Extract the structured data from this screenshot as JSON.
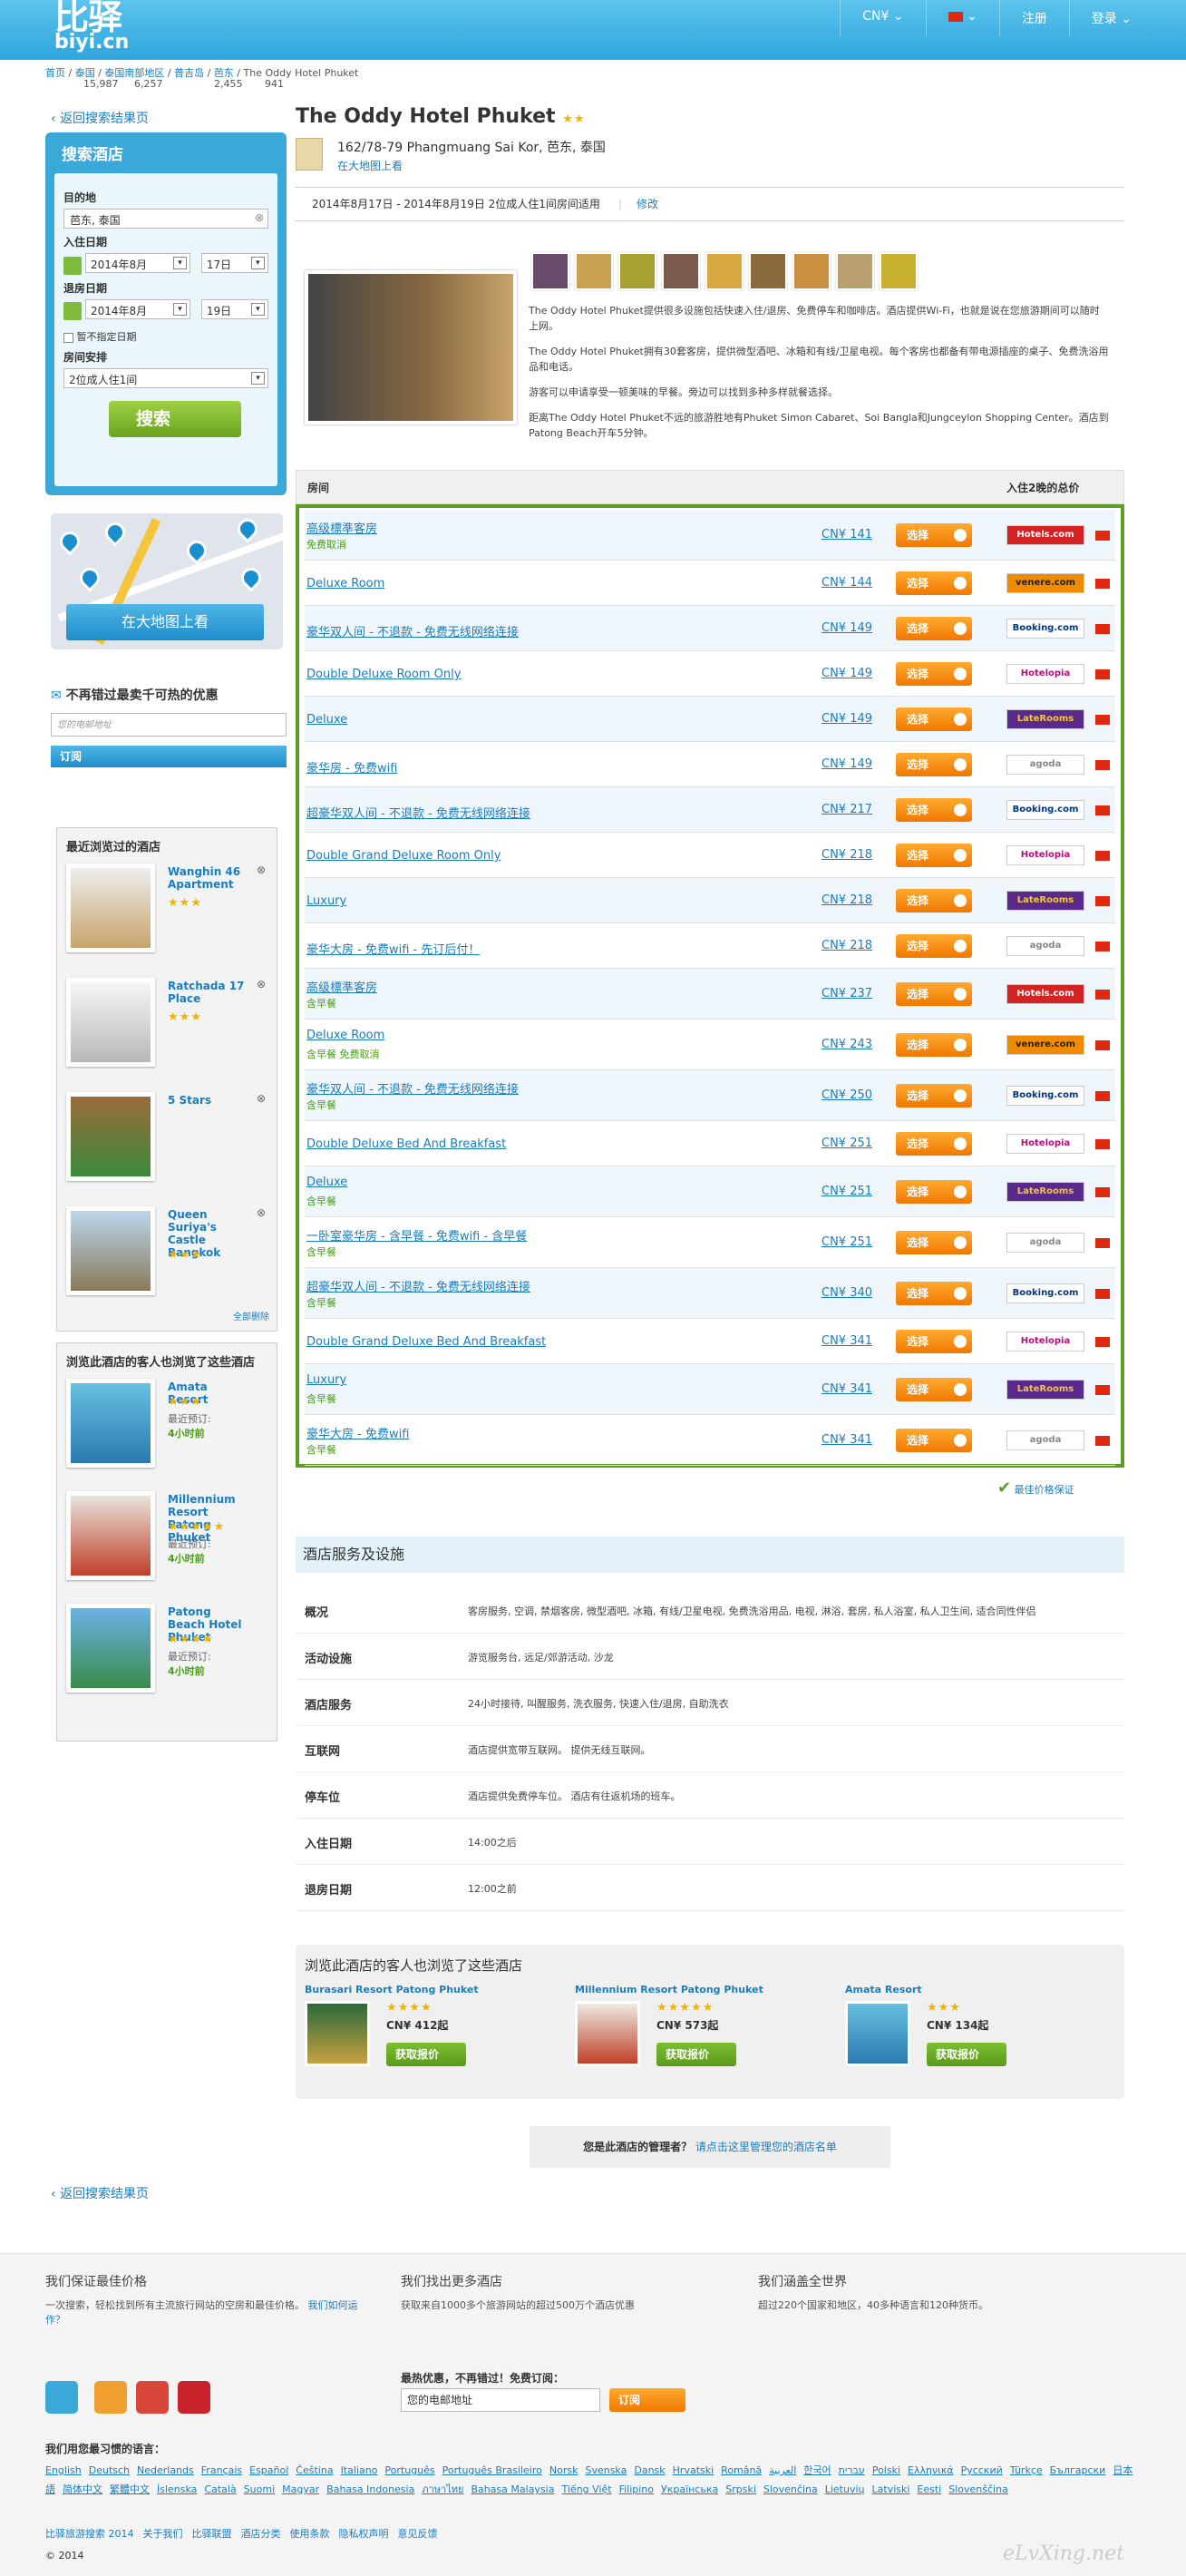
{
  "header": {
    "logo_top": "比驿",
    "logo_domain": "biyi.cn",
    "currency": "CN¥",
    "register": "注册",
    "login": "登录"
  },
  "breadcrumb": [
    {
      "label": "首页",
      "count": ""
    },
    {
      "label": "泰国",
      "count": "15,987"
    },
    {
      "label": "泰国南部地区",
      "count": "6,257"
    },
    {
      "label": "普吉岛",
      "count": "2,455"
    },
    {
      "label": "芭东",
      "count": "941"
    },
    {
      "label": "The Oddy Hotel Phuket",
      "count": ""
    }
  ],
  "back_label": "返回搜索结果页",
  "search": {
    "title": "搜索酒店",
    "dest_label": "目的地",
    "dest_value": "芭东, 泰国",
    "checkin_label": "入住日期",
    "checkin_month": "2014年8月",
    "checkin_day": "17日",
    "checkout_label": "退房日期",
    "checkout_month": "2014年8月",
    "checkout_day": "19日",
    "nodate_label": "暂不指定日期",
    "room_label": "房间安排",
    "room_value": "2位成人住1间",
    "button": "搜索"
  },
  "map_button": "在大地图上看",
  "newsletter": {
    "title": "不再错过最卖千可热的优惠",
    "placeholder": "您的电邮地址",
    "button": "订阅"
  },
  "recent": {
    "title": "最近浏览过的酒店",
    "items": [
      {
        "name": "Wanghin 46 Apartment",
        "stars": "★★★"
      },
      {
        "name": "Ratchada 17 Place",
        "stars": "★★★"
      },
      {
        "name": "5 Stars",
        "stars": ""
      },
      {
        "name": "Queen Suriya's Castle Bangkok",
        "stars": "★★★"
      }
    ],
    "all": "全部删除"
  },
  "also_viewed": {
    "title": "浏览此酒店的客人也浏览了这些酒店",
    "items": [
      {
        "name": "Amata Resort",
        "stars": "★★★",
        "note": "最近预订:",
        "time": "4小时前"
      },
      {
        "name": "Millennium Resort Patong Phuket",
        "stars": "★★★★★",
        "note": "最近预订:",
        "time": "4小时前"
      },
      {
        "name": "Patong Beach Hotel Phuket",
        "stars": "★★★★",
        "note": "最近预订:",
        "time": "4小时前"
      }
    ]
  },
  "hotel": {
    "name": "The Oddy Hotel Phuket",
    "stars": "★★",
    "address": "162/78-79 Phangmuang Sai Kor, 芭东, 泰国",
    "map_link": "在大地图上看",
    "dates": "2014年8月17日 - 2014年8月19日 2位成人住1间房间适用",
    "edit": "修改",
    "desc": [
      "The Oddy Hotel Phuket提供很多设施包括快速入住/退房、免费停车和咖啡店。酒店提供Wi-Fi，也就是说在您旅游期间可以随时上网。",
      "The Oddy Hotel Phuket拥有30套客房，提供微型酒吧、冰箱和有线/卫星电视。每个客房也都备有带电源插座的桌子、免费洗浴用品和电话。",
      "游客可以申请享受一顿美味的早餐。旁边可以找到多种多样就餐选择。",
      "距离The Oddy Hotel Phuket不远的旅游胜地有Phuket Simon Cabaret、Soi Bangla和Jungceylon Shopping Center。酒店到Patong Beach开车5分钟。"
    ]
  },
  "rates": {
    "col_room": "房间",
    "col_price": "入住2晚的总价",
    "select": "选择",
    "rows": [
      {
        "name": "高级標準客房",
        "sub": "免费取消",
        "price": "CN¥ 141",
        "provider": "Hotels.com"
      },
      {
        "name": "Deluxe Room",
        "sub": "",
        "price": "CN¥ 144",
        "provider": "venere.com"
      },
      {
        "name": "豪华双人间 - 不退款 - 免费无线网络连接",
        "sub": "",
        "price": "CN¥ 149",
        "provider": "Booking.com"
      },
      {
        "name": "Double Deluxe Room Only",
        "sub": "",
        "price": "CN¥ 149",
        "provider": "Hotelopia"
      },
      {
        "name": "Deluxe",
        "sub": "",
        "price": "CN¥ 149",
        "provider": "LateRooms"
      },
      {
        "name": "豪华房 - 免费wifi",
        "sub": "",
        "price": "CN¥ 149",
        "provider": "agoda"
      },
      {
        "name": "超豪华双人间 - 不退款 - 免费无线网络连接",
        "sub": "",
        "price": "CN¥ 217",
        "provider": "Booking.com"
      },
      {
        "name": "Double Grand Deluxe Room Only",
        "sub": "",
        "price": "CN¥ 218",
        "provider": "Hotelopia"
      },
      {
        "name": "Luxury",
        "sub": "",
        "price": "CN¥ 218",
        "provider": "LateRooms"
      },
      {
        "name": "豪华大房 - 免费wifi - 先订后付！",
        "sub": "",
        "price": "CN¥ 218",
        "provider": "agoda"
      },
      {
        "name": "高级標準客房",
        "sub": "含早餐",
        "price": "CN¥ 237",
        "provider": "Hotels.com"
      },
      {
        "name": "Deluxe Room",
        "sub": "含早餐 免费取消",
        "price": "CN¥ 243",
        "provider": "venere.com"
      },
      {
        "name": "豪华双人间 - 不退款 - 免费无线网络连接",
        "sub": "含早餐",
        "price": "CN¥ 250",
        "provider": "Booking.com"
      },
      {
        "name": "Double Deluxe Bed And Breakfast",
        "sub": "",
        "price": "CN¥ 251",
        "provider": "Hotelopia"
      },
      {
        "name": "Deluxe",
        "sub": "含早餐",
        "price": "CN¥ 251",
        "provider": "LateRooms"
      },
      {
        "name": "一卧室豪华房 - 含早餐 - 免费wifi - 含早餐",
        "sub": "含早餐",
        "price": "CN¥ 251",
        "provider": "agoda"
      },
      {
        "name": "超豪华双人间 - 不退款 - 免费无线网络连接",
        "sub": "含早餐",
        "price": "CN¥ 340",
        "provider": "Booking.com"
      },
      {
        "name": "Double Grand Deluxe Bed And Breakfast",
        "sub": "",
        "price": "CN¥ 341",
        "provider": "Hotelopia"
      },
      {
        "name": "Luxury",
        "sub": "含早餐",
        "price": "CN¥ 341",
        "provider": "LateRooms"
      },
      {
        "name": "豪华大房 - 免费wifi",
        "sub": "含早餐",
        "price": "CN¥ 341",
        "provider": "agoda"
      }
    ],
    "guarantee": "最佳价格保证"
  },
  "services": {
    "title": "酒店服务及设施",
    "rows": [
      {
        "k": "概况",
        "v": "客房服务, 空调, 禁烟客房, 微型酒吧, 冰箱, 有线/卫星电视, 免费洗浴用品, 电视, 淋浴, 套房, 私人浴室, 私人卫生间, 适合同性伴侣"
      },
      {
        "k": "活动设施",
        "v": "游览服务台, 远足/郊游活动, 沙龙"
      },
      {
        "k": "酒店服务",
        "v": "24小时接待, 叫醒服务, 洗衣服务, 快速入住/退房, 自助洗衣"
      },
      {
        "k": "互联网",
        "v": "酒店提供宽带互联网。 提供无线互联网。"
      },
      {
        "k": "停车位",
        "v": "酒店提供免费停车位。 酒店有往返机场的班车。"
      },
      {
        "k": "入住日期",
        "v": "14:00之后"
      },
      {
        "k": "退房日期",
        "v": "12:00之前"
      }
    ]
  },
  "similar": {
    "title": "浏览此酒店的客人也浏览了这些酒店",
    "items": [
      {
        "name": "Burasari Resort Patong Phuket",
        "stars": "★★★★",
        "price": "CN¥ 412起",
        "btn": "获取报价"
      },
      {
        "name": "Millennium Resort Patong Phuket",
        "stars": "★★★★★",
        "price": "CN¥ 573起",
        "btn": "获取报价"
      },
      {
        "name": "Amata Resort",
        "stars": "★★★",
        "price": "CN¥ 134起",
        "btn": "获取报价"
      }
    ]
  },
  "admin": {
    "text": "您是此酒店的管理者？",
    "link": "请点击这里管理您的酒店名单"
  },
  "footer": {
    "c1_title": "我们保证最佳价格",
    "c1_text": "一次搜索，轻松找到所有主流旅行网站的空房和最佳价格。",
    "c1_link": "我们如何运作？",
    "c2_title": "我们找出更多酒店",
    "c2_text": "获取来自1000多个旅游网站的超过500万个酒店优惠",
    "c3_title": "我们涵盖全世界",
    "c3_text": "超过220个国家和地区，40多种语言和120种货币。",
    "nl_title": "最热优惠，不再错过！免费订阅：",
    "nl_placeholder": "您的电邮地址",
    "nl_button": "订阅",
    "lang_title": "我们用您最习惯的语言：",
    "langs": [
      "English",
      "Deutsch",
      "Nederlands",
      "Français",
      "Español",
      "Čeština",
      "Italiano",
      "Português",
      "Português Brasileiro",
      "Norsk",
      "Svenska",
      "Dansk",
      "Hrvatski",
      "Română",
      "العربية",
      "한국어",
      "עברית",
      "Polski",
      "Ελληνικά",
      "Русский",
      "Türkçe",
      "Български",
      "日本語",
      "简体中文",
      "繁體中文",
      "Íslenska",
      "Català",
      "Suomi",
      "Magyar",
      "Bahasa Indonesia",
      "ภาษาไทย",
      "Bahasa Malaysia",
      "Tiếng Việt",
      "Filipino",
      "Українська",
      "Srpski",
      "Slovenčina",
      "Lietuvių",
      "Latviski",
      "Eesti",
      "Slovenščina"
    ],
    "links": [
      "比驿旅游搜索 2014",
      "关于我们",
      "比驿联盟",
      "酒店分类",
      "使用条款",
      "隐私权声明",
      "意见反馈"
    ],
    "copyright": "© 2014",
    "watermark": "eLvXing.net"
  }
}
